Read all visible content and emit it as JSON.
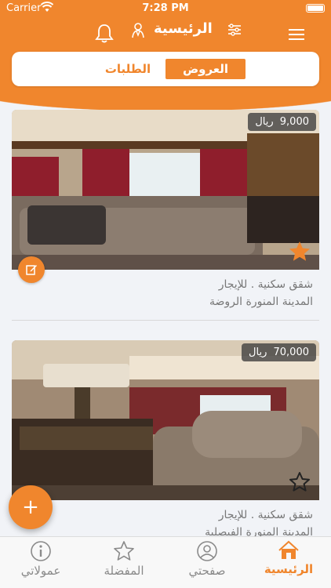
{
  "status_bar": {
    "carrier": "Carrier",
    "time": "7:28 PM"
  },
  "header": {
    "title": "الرئيسية",
    "icons": [
      "menu-icon",
      "filter-icon",
      "person-icon",
      "bell-icon"
    ]
  },
  "tabs": [
    {
      "label": "العروض",
      "active": true
    },
    {
      "label": "الطلبات",
      "active": false
    }
  ],
  "listings": [
    {
      "price": "9,000",
      "currency": "ريال",
      "title": "شقق سكنية . للإيجار",
      "location": "المدينة المنورة الروضة",
      "favorite": true
    },
    {
      "price": "70,000",
      "currency": "ريال",
      "title": "شقق سكنية . للإيجار",
      "location": "المدينة المنورة الفيصلية",
      "favorite": false
    }
  ],
  "fab": {
    "label": "+"
  },
  "bottom_nav": [
    {
      "label": "الرئيسية",
      "icon": "home-icon",
      "active": true
    },
    {
      "label": "صفحتي",
      "icon": "user-icon",
      "active": false
    },
    {
      "label": "المفضلة",
      "icon": "star-icon",
      "active": false
    },
    {
      "label": "عمولاتي",
      "icon": "info-icon",
      "active": false
    }
  ],
  "colors": {
    "accent": "#f0862d",
    "background": "#f1f3f7",
    "muted_text": "#777777"
  }
}
